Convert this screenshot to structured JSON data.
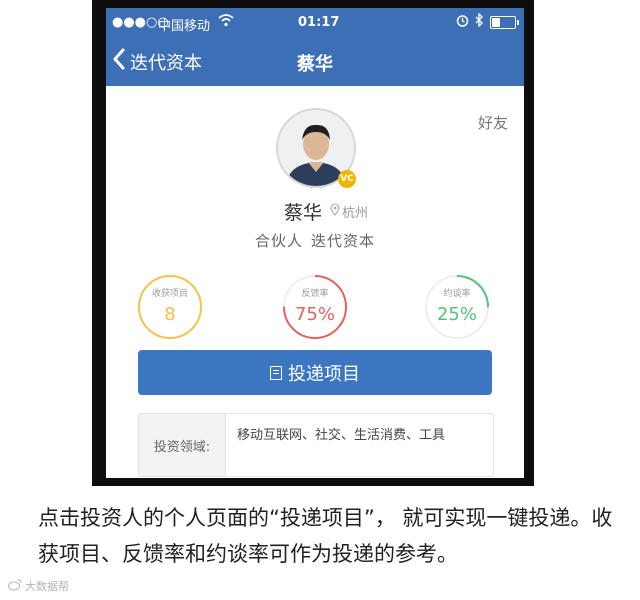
{
  "status_bar": {
    "carrier": "中国移动",
    "time": "01:17"
  },
  "nav": {
    "back_label": "迭代资本",
    "title": "蔡华"
  },
  "profile": {
    "friend_label": "好友",
    "badge_text": "VC",
    "name": "蔡华",
    "location": "杭州",
    "title": "合伙人",
    "company": "迭代资本"
  },
  "stats": [
    {
      "label": "收获项目",
      "value": "8",
      "color": "#f2c44a",
      "progress": 1.0
    },
    {
      "label": "反馈率",
      "value": "75%",
      "color": "#e2625e",
      "progress": 0.75
    },
    {
      "label": "约谈率",
      "value": "25%",
      "color": "#53c27a",
      "progress": 0.25
    }
  ],
  "deliver_button": {
    "label": "投递项目"
  },
  "investment": {
    "label": "投资领域:",
    "value": "移动互联网、社交、生活消费、工具"
  },
  "caption": "点击投资人的个人页面的“投递项目”， 就可实现一键投递。收获项目、反馈率和约谈率可作为投递的参考。",
  "watermark": "大数据帮"
}
